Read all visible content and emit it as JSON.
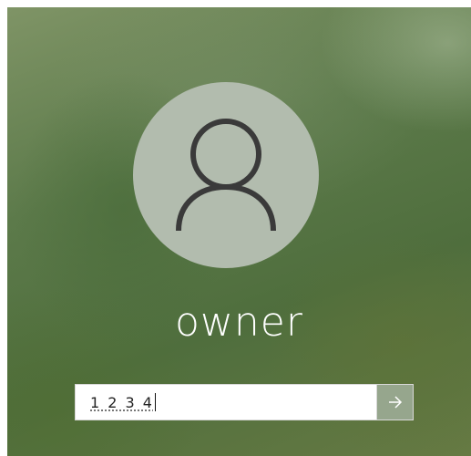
{
  "lock_screen": {
    "user": {
      "name": "owner",
      "avatar_icon": "person-icon"
    },
    "pin_field": {
      "value": "1 2 3 4"
    },
    "submit_icon": "arrow-right-icon",
    "colors": {
      "avatar_bg": "#b2bcae",
      "text": "#ffffff",
      "submit_bg": "#a0af9b"
    }
  }
}
